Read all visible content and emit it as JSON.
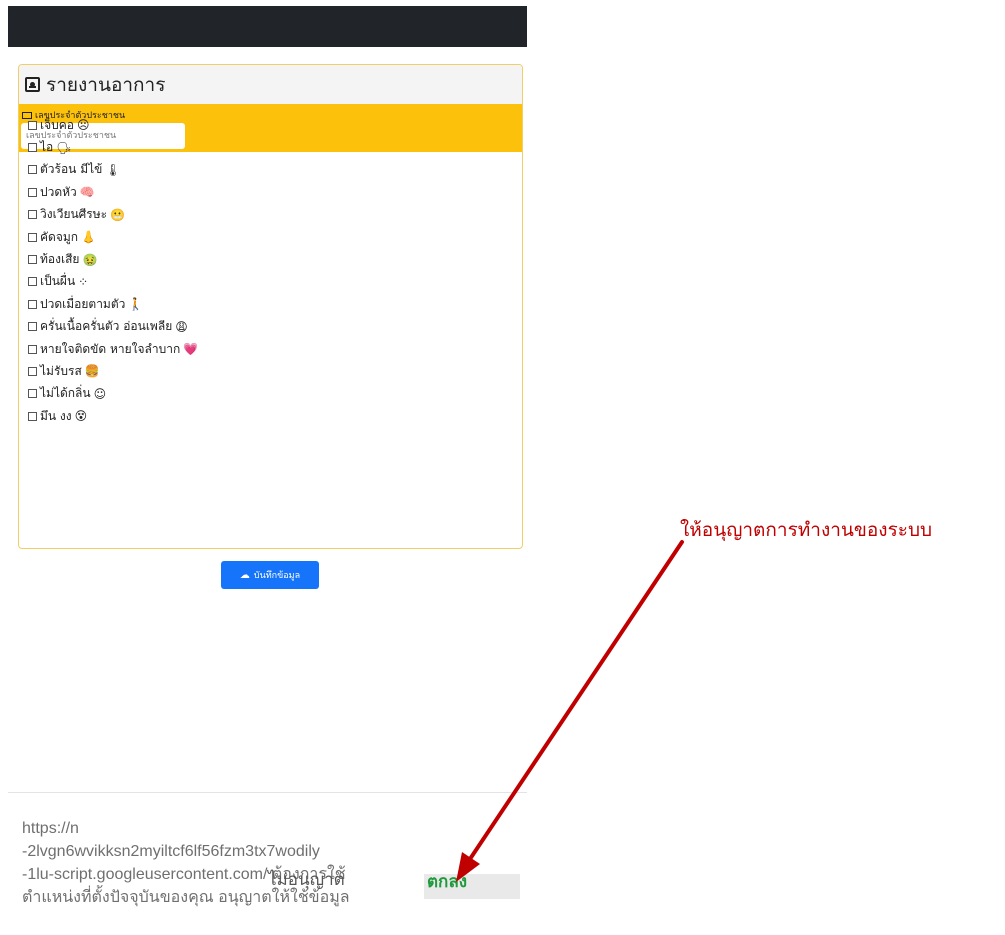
{
  "header": {
    "title": "รายงานอาการ",
    "title_icon": "id-card-icon"
  },
  "id_section": {
    "label": "เลขประจำตัวประชาชน",
    "input_placeholder": "เลขประจำตัวประชาชน",
    "input_value": ""
  },
  "symptoms": [
    {
      "label": "เจ็บคอ",
      "icon": "☹",
      "checked": false
    },
    {
      "label": "ไอ",
      "icon": "🗣",
      "checked": false
    },
    {
      "label": "ตัวร้อน มีไข้",
      "icon": "🌡",
      "checked": false
    },
    {
      "label": "ปวดหัว",
      "icon": "🧠",
      "checked": false
    },
    {
      "label": "วิงเวียนศีรษะ",
      "icon": "😬",
      "checked": false
    },
    {
      "label": "คัดจมูก",
      "icon": "👃",
      "checked": false
    },
    {
      "label": "ท้องเสีย",
      "icon": "🤢",
      "checked": false
    },
    {
      "label": "เป็นผื่น",
      "icon": "⁘",
      "checked": false
    },
    {
      "label": "ปวดเมื่อยตามตัว",
      "icon": "🚶",
      "checked": false
    },
    {
      "label": "ครั่นเนื้อครั่นตัว อ่อนเพลีย",
      "icon": "😩",
      "checked": false
    },
    {
      "label": "หายใจติดขัด หายใจลำบาก",
      "icon": "💗",
      "checked": false
    },
    {
      "label": "ไม่รับรส",
      "icon": "🍔",
      "checked": false
    },
    {
      "label": "ไม่ได้กลิ่น",
      "icon": "☺",
      "checked": false
    },
    {
      "label": "มึน งง",
      "icon": "😵",
      "checked": false
    }
  ],
  "save_button": {
    "label": "บันทึกข้อมูล",
    "icon": "cloud-upload-icon"
  },
  "permission_dialog": {
    "lines": [
      "https://n",
      "-2lvgn6wvikksn2myiltcf6lf56fzm3tx7wodily",
      "-1lu-script.googleusercontent.com/ ต้องการใช้",
      "ตำแหน่งที่ตั้งปัจจุบันของคุณ อนุญาตให้ใช้ข้อมูล"
    ],
    "deny_label": "ไม่อนุญาต",
    "allow_label": "ตกลง"
  },
  "annotation": {
    "text": "ให้อนุญาตการทำงานของระบบ",
    "color": "#c00000"
  },
  "colors": {
    "topbar": "#212529",
    "section": "#fcc10a",
    "button": "#1674fb",
    "allow": "#1f9a3e"
  }
}
